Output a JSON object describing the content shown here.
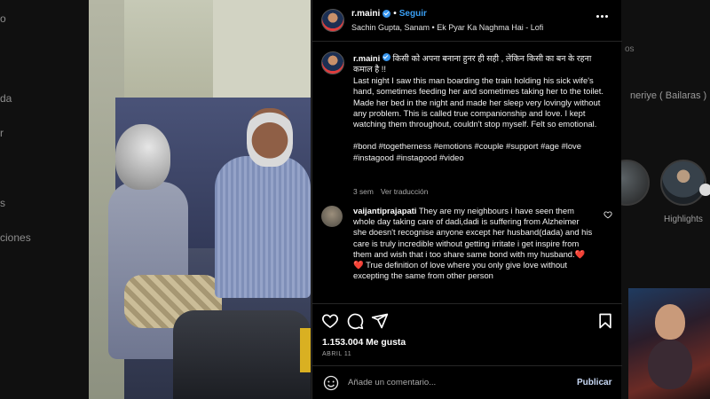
{
  "backdrop": {
    "left_fragments": [
      "o",
      "da",
      "r",
      "s",
      "ciones"
    ],
    "right_fragments": {
      "partial_text": "os",
      "row_text": "neriye ( Bailaras ) | Mile",
      "highlights_label": "Highlights"
    }
  },
  "header": {
    "username": "r.maini",
    "separator": "•",
    "follow_label": "Seguir",
    "song": "Sachin Gupta, Sanam • Ek Pyar Ka Naghma Hai - Lofi"
  },
  "caption": {
    "username": "r.maini",
    "text_hindi": "किसी को अपना बनाना हुनर ही सही , लेकिन किसी का बन के रहना कमाल है !!",
    "body": "Last night I saw this man boarding the train holding his sick wife's hand, sometimes feeding her and sometimes taking her to the toilet. Made her bed in the night and made her sleep very lovingly without any problem. This is called true companionship and love. I kept watching them throughout, couldn't stop myself. Felt so emotional.",
    "hashtags": "#bond #togetherness #emotions #couple #support #age #love #instagood #instagood #video",
    "time_ago": "3 sem",
    "see_translation": "Ver traducción"
  },
  "comment": {
    "username": "vaijantiprajapati",
    "text_before_hearts": "They are my neighbours i have seen them whole day taking care of dadi,dadi is suffering from Alzheimer she doesn't recognise anyone except her husband(dada) and his care is truly incredible without getting irritate i get inspire from them and wish that i too share same bond with my husband.",
    "hearts": "❤️❤️",
    "text_after_hearts": " True definition of love where you only give love without excepting the same from other person"
  },
  "actions": {
    "likes": "1.153.004 Me gusta",
    "date": "ABRIL 11"
  },
  "composer": {
    "placeholder": "Añade un comentario...",
    "publish_label": "Publicar"
  },
  "icons": {
    "like": "heart-icon",
    "comment": "comment-icon",
    "share": "send-icon",
    "save": "bookmark-icon",
    "emoji": "emoji-icon",
    "more": "more-icon",
    "mute": "mute-icon",
    "verified": "verified-badge-icon"
  },
  "colors": {
    "accent": "#3aa0f5",
    "verified": "#3897f0",
    "panel_bg": "#000000",
    "muted_text": "#a8a8a8"
  }
}
